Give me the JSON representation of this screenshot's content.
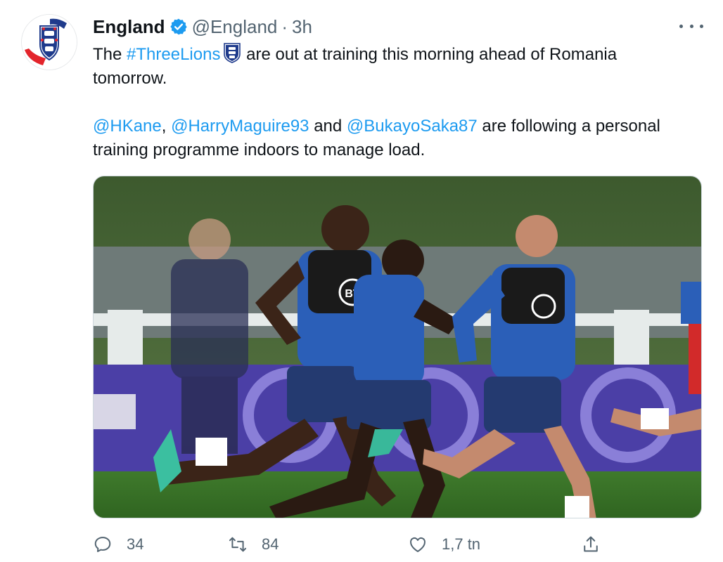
{
  "tweet": {
    "display_name": "England",
    "handle": "@England",
    "separator": "·",
    "time": "3h",
    "text": {
      "line1_prefix": "The ",
      "hashtag": "#ThreeLions",
      "line1_suffix": " are out at training this morning ahead of Romania",
      "line2": "tomorrow.",
      "mention1": "@HKane",
      "comma": ", ",
      "mention2": "@HarryMaguire93",
      "and": " and ",
      "mention3": "@BukayoSaka87",
      "line3_suffix": " are following a personal",
      "line4": "training programme indoors to manage load."
    },
    "media_jersey_logo": "BT",
    "icons": {
      "verified": "verified-badge-icon",
      "more": "more-icon",
      "reply": "reply-icon",
      "retweet": "retweet-icon",
      "like": "like-icon",
      "share": "share-icon"
    },
    "actions": {
      "reply_count": "34",
      "retweet_count": "84",
      "like_count": "1,7 tn"
    },
    "colors": {
      "accent": "#1d9bf0",
      "text": "#0f1419",
      "secondary": "#536471"
    }
  }
}
